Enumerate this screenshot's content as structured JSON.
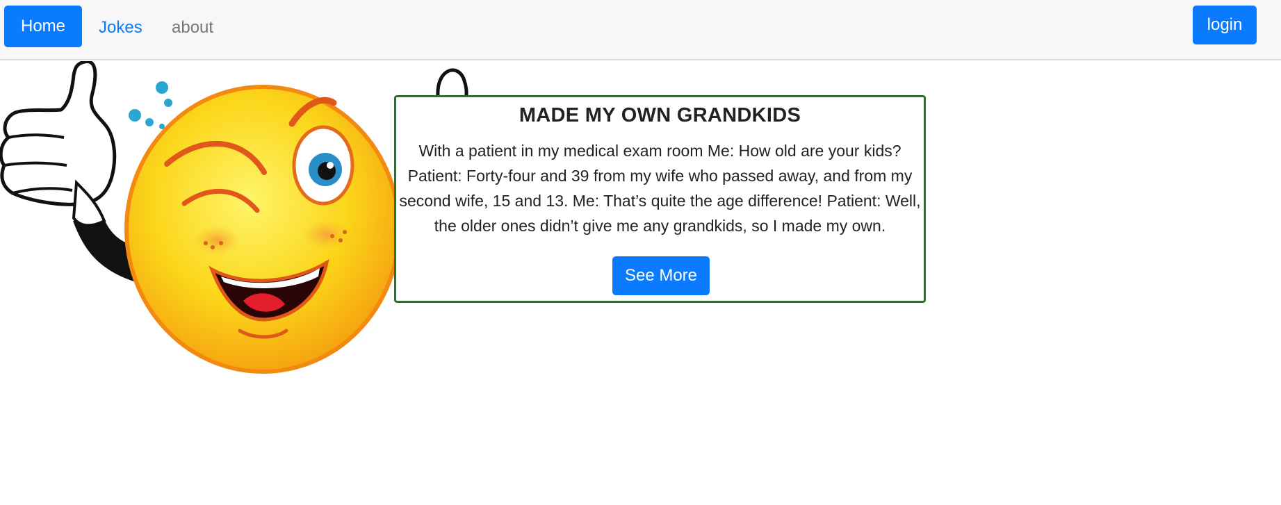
{
  "nav": {
    "home_label": "Home",
    "jokes_label": "Jokes",
    "about_label": "about",
    "login_label": "login"
  },
  "joke": {
    "title": "MADE MY OWN GRANDKIDS",
    "text": "With a patient in my medical exam room Me: How old are your kids? Patient: Forty-four and 39 from my wife who passed away, and from my second wife, 15 and 13. Me: That’s quite the age difference! Patient: Well, the older ones didn’t give me any grandkids, so I made my own.",
    "button_label": "See More"
  },
  "colors": {
    "primary": "#0a7bff",
    "card_border": "#1f7a1f",
    "navbar_bg": "#f7f7f7"
  },
  "icons": {
    "hero_image": "winking-thumbs-up-smiley-icon"
  }
}
